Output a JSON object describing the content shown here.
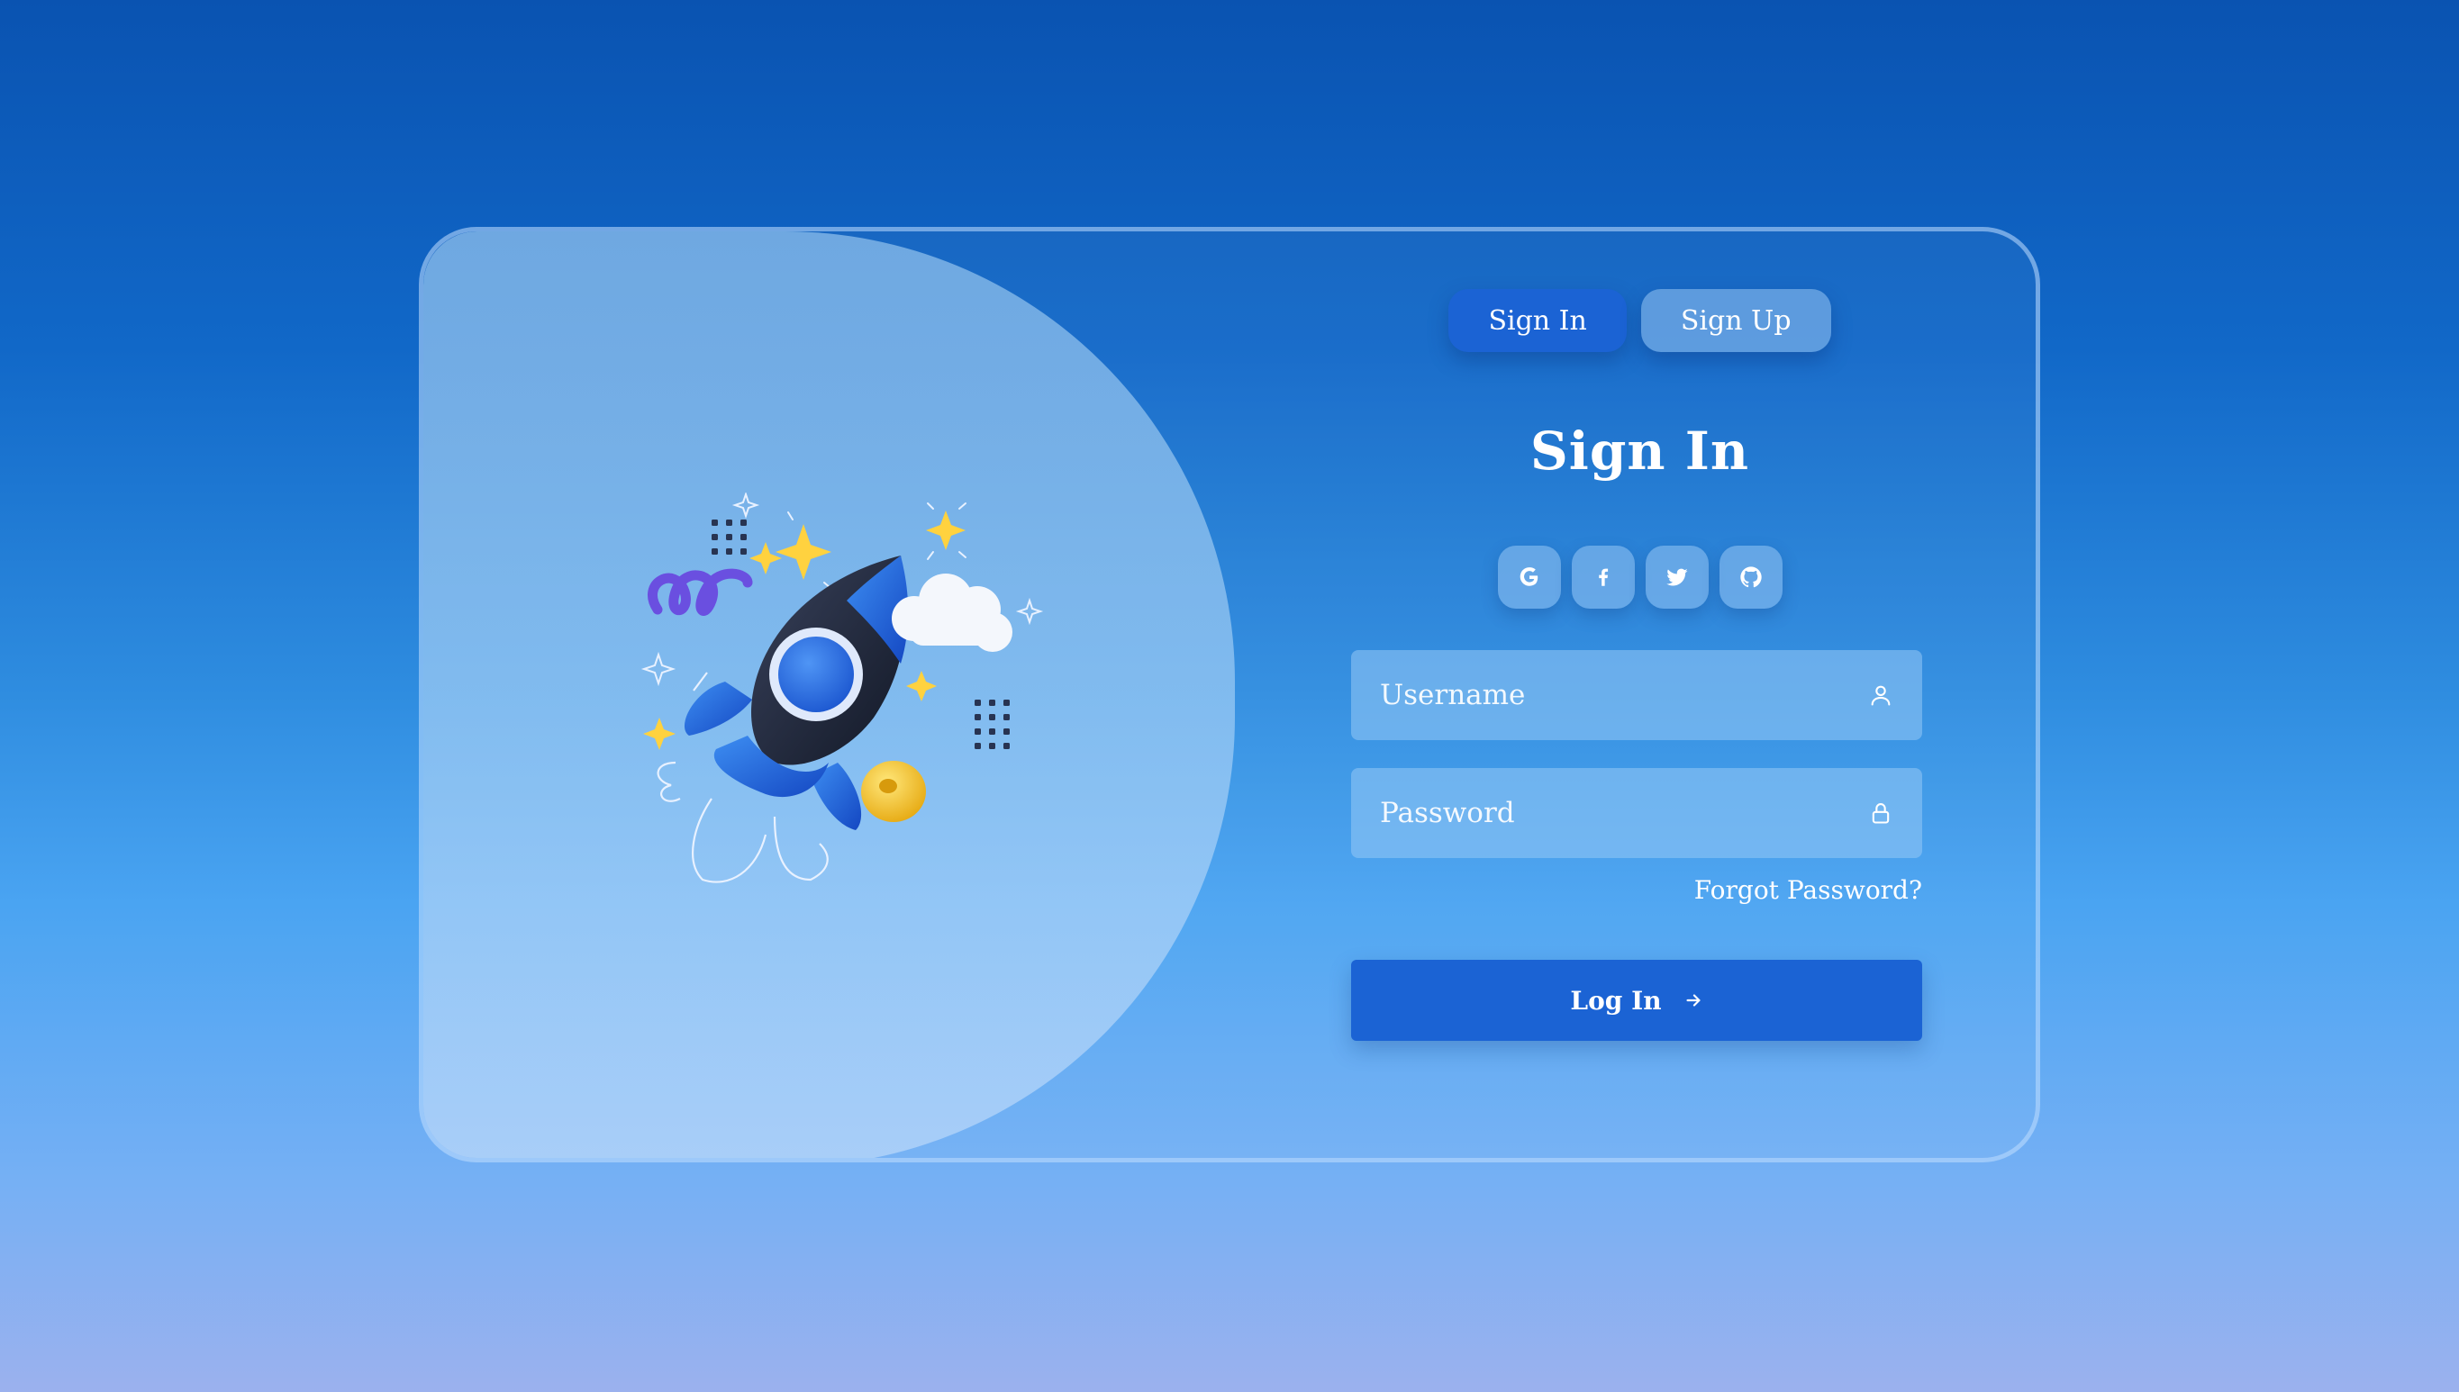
{
  "tabs": {
    "sign_in": "Sign In",
    "sign_up": "Sign Up"
  },
  "form": {
    "title": "Sign In",
    "username_placeholder": "Username",
    "password_placeholder": "Password",
    "forgot_password": "Forgot Password?",
    "login_button": "Log In"
  },
  "socials": [
    {
      "icon": "google-icon"
    },
    {
      "icon": "facebook-icon"
    },
    {
      "icon": "twitter-icon"
    },
    {
      "icon": "github-icon"
    }
  ],
  "icons": {
    "username": "user-icon",
    "password": "lock-icon",
    "login": "arrow-right-icon"
  },
  "colors": {
    "accent": "#1b63d4",
    "background_top": "#0a53b1",
    "background_bottom": "#9bb1ee"
  }
}
